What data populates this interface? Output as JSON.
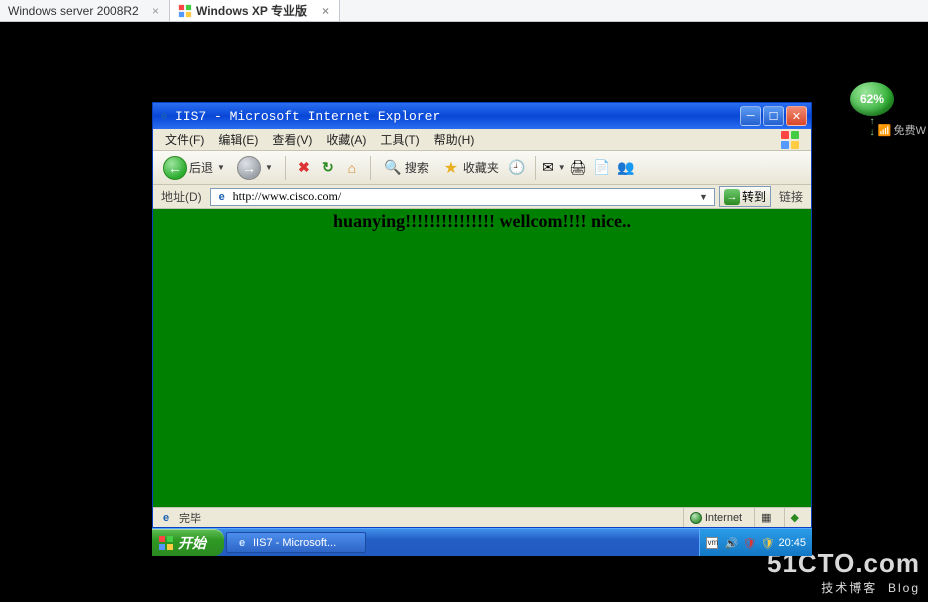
{
  "host_tabs": {
    "tab1": "Windows server 2008R2",
    "tab2": "Windows XP 专业版"
  },
  "overlay": {
    "battery_percent": "62%",
    "wifi_label": "免费W",
    "watermark_main": "51CTO.com",
    "watermark_sub": "技术博客",
    "watermark_blog": "Blog"
  },
  "ie": {
    "title": "IIS7 - Microsoft Internet Explorer",
    "menus": {
      "file": "文件(F)",
      "edit": "编辑(E)",
      "view": "查看(V)",
      "fav": "收藏(A)",
      "tools": "工具(T)",
      "help": "帮助(H)"
    },
    "toolbar": {
      "back": "后退",
      "search": "搜索",
      "favorites": "收藏夹"
    },
    "address_label": "地址(D)",
    "url": "http://www.cisco.com/",
    "go_label": "转到",
    "links_label": "链接",
    "page_text": "huanying!!!!!!!!!!!!!!! wellcom!!!! nice..",
    "status_done": "完毕",
    "status_zone": "Internet"
  },
  "taskbar": {
    "start": "开始",
    "task1": "IIS7 - Microsoft...",
    "clock": "20:45"
  }
}
